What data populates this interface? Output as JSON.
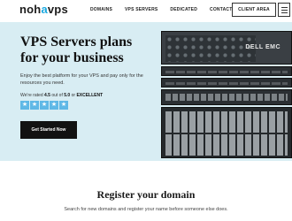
{
  "header": {
    "logo": {
      "part1": "noh",
      "part2": "a",
      "part3": "vps"
    },
    "nav": [
      "DOMAINS",
      "VPS SERVERS",
      "DEDICATED",
      "CONTACT"
    ],
    "client_area": "CLIENT AREA"
  },
  "hero": {
    "title": "VPS Servers plans for your business",
    "description": "Enjoy the best platform for your VPS and pay only for the resources you need.",
    "rating": {
      "prefix": "We're rated",
      "score": "4.5",
      "mid": "out of",
      "max": "5.0",
      "or": "or",
      "label": "EXCELLENT"
    },
    "stars": 5,
    "cta": "Get Started Now",
    "server_brand": "DELL EMC"
  },
  "register": {
    "title": "Register your domain",
    "subtitle": "Search for new domains and register your name before someone else does."
  },
  "colors": {
    "hero_bg": "#d8edf3",
    "accent": "#1aa9e0",
    "star": "#5fb8e6",
    "cta_bg": "#121212"
  }
}
